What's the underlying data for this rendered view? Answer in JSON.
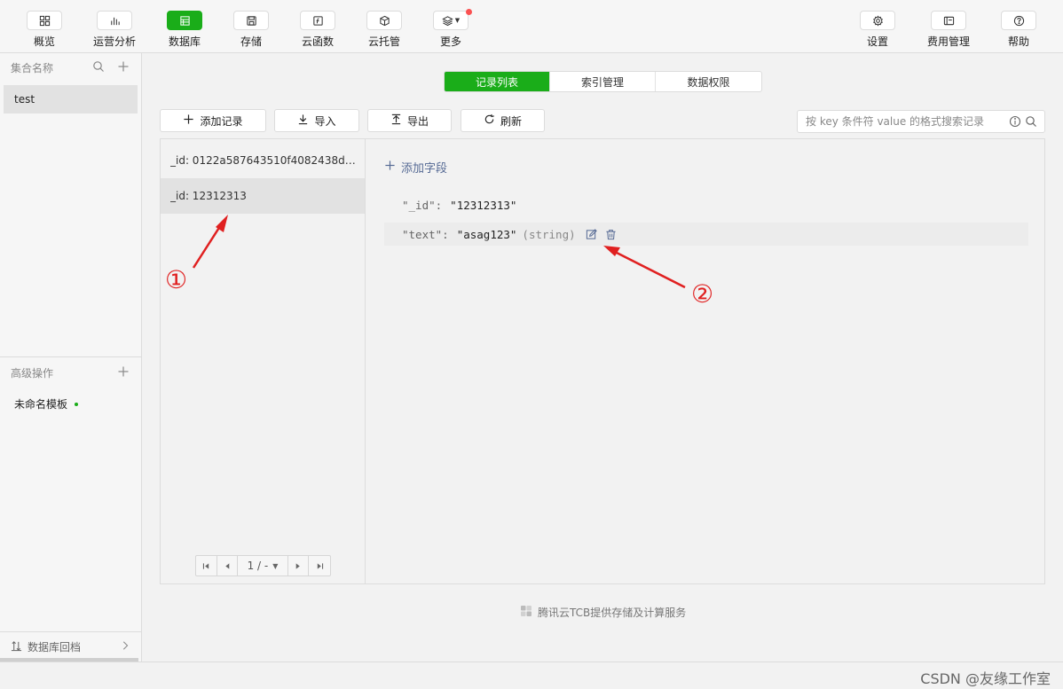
{
  "toolbar": {
    "items": [
      {
        "label": "概览",
        "icon": "grid-icon"
      },
      {
        "label": "运营分析",
        "icon": "bar-chart-icon"
      },
      {
        "label": "数据库",
        "icon": "database-icon"
      },
      {
        "label": "存储",
        "icon": "save-icon"
      },
      {
        "label": "云函数",
        "icon": "function-icon"
      },
      {
        "label": "云托管",
        "icon": "cube-icon"
      },
      {
        "label": "更多",
        "icon": "layers-icon"
      },
      {
        "label": "设置",
        "icon": "gear-icon"
      },
      {
        "label": "费用管理",
        "icon": "billing-icon"
      },
      {
        "label": "帮助",
        "icon": "help-icon"
      }
    ],
    "active": "数据库",
    "accent_color": "#1aad19"
  },
  "sidebar": {
    "collections_header": "集合名称",
    "collections": [
      "test"
    ],
    "advanced_header": "高级操作",
    "templates": [
      "未命名模板"
    ],
    "footer_label": "数据库回档"
  },
  "tabs": [
    "记录列表",
    "索引管理",
    "数据权限"
  ],
  "actions": {
    "add_record": "添加记录",
    "import": "导入",
    "export": "导出",
    "refresh": "刷新"
  },
  "search": {
    "placeholder": "按 key 条件符 value 的格式搜索记录"
  },
  "records": [
    "_id: 0122a587643510f4082438d62f...",
    "_id: 12312313"
  ],
  "pagination": {
    "label": "1 / -"
  },
  "detail": {
    "add_field": "添加字段",
    "fields": [
      {
        "key": "\"_id\"",
        "value": "\"12312313\"",
        "type": ""
      },
      {
        "key": "\"text\"",
        "value": "\"asag123\"",
        "type": "(string)"
      }
    ]
  },
  "footer_note": "腾讯云TCB提供存储及计算服务",
  "annotations": {
    "one": "①",
    "two": "②",
    "color": "#e02020"
  },
  "watermark": "CSDN @友缘工作室"
}
